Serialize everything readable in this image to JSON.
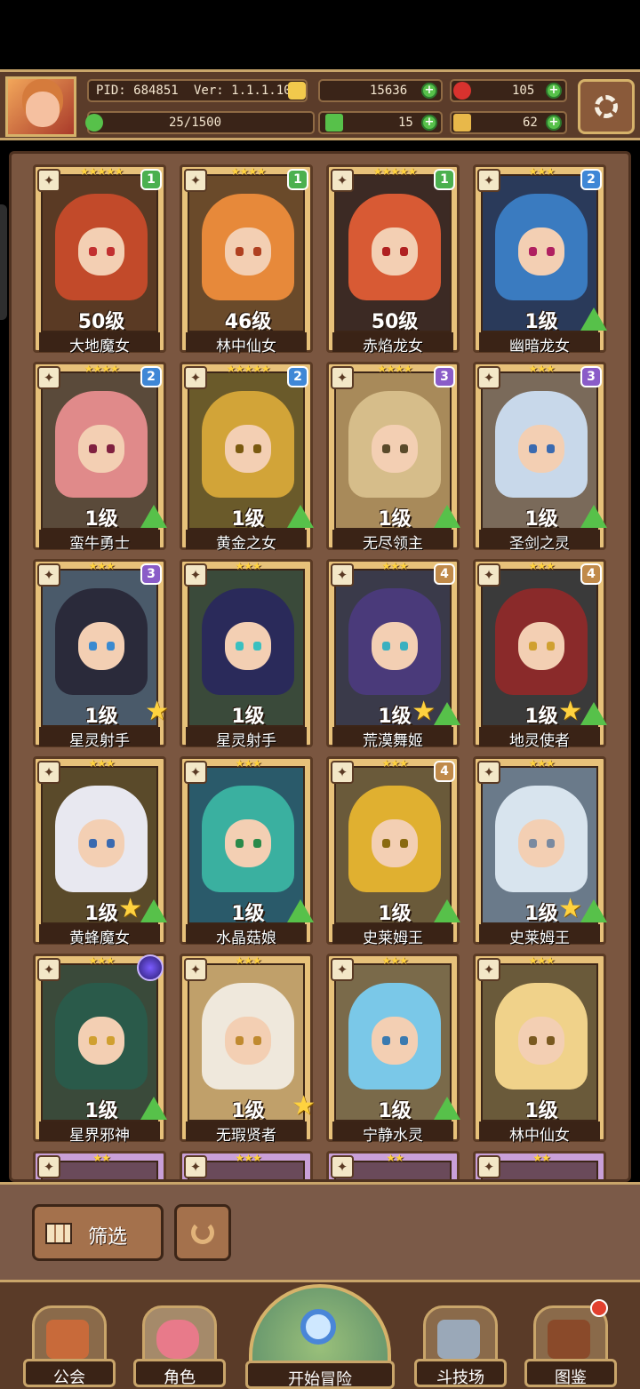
{
  "header": {
    "pid": "PID: 684851",
    "version": "Ver: 1.1.1.10",
    "exp": "25/1500",
    "gold": "15636",
    "gems": "105",
    "clover": "15",
    "keys": "62"
  },
  "colors": {
    "plus": "#57c14a",
    "accent_gold": "#d6b26a",
    "panel": "#5b3c2a"
  },
  "characters": [
    {
      "name": "大地魔女",
      "level": "50级",
      "stars": "★★★★★",
      "badge": "1",
      "badge_color": "#4bb04f",
      "icon": "staff-icon",
      "hair": "#c24a2a",
      "eye": "#c23030",
      "bg": "#5a3a24",
      "status": "none"
    },
    {
      "name": "林中仙女",
      "level": "46级",
      "stars": "★★★★",
      "badge": "1",
      "badge_color": "#4bb04f",
      "icon": "leaf-icon",
      "hair": "#e7893a",
      "eye": "#b04020",
      "bg": "#6a4a2a",
      "status": "none"
    },
    {
      "name": "赤焰龙女",
      "level": "50级",
      "stars": "★★★★★",
      "badge": "1",
      "badge_color": "#4bb04f",
      "icon": "staff-icon",
      "hair": "#d85a34",
      "eye": "#b02020",
      "bg": "#3c2a24",
      "status": "none"
    },
    {
      "name": "幽暗龙女",
      "level": "1级",
      "stars": "★★★",
      "badge": "2",
      "badge_color": "#3f87d6",
      "icon": "staff-icon",
      "hair": "#3a7bc0",
      "eye": "#b02060",
      "bg": "#2a3a5a",
      "status": "upgrade"
    },
    {
      "name": "蛮牛勇士",
      "level": "1级",
      "stars": "★★★★",
      "badge": "2",
      "badge_color": "#3f87d6",
      "icon": "sword-icon",
      "hair": "#e08a8a",
      "eye": "#802040",
      "bg": "#5a4a3a",
      "status": "upgrade"
    },
    {
      "name": "黄金之女",
      "level": "1级",
      "stars": "★★★★★",
      "badge": "2",
      "badge_color": "#3f87d6",
      "icon": "staff-icon",
      "hair": "#d2a438",
      "eye": "#7a5a10",
      "bg": "#6a5a2a",
      "status": "upgrade"
    },
    {
      "name": "无尽领主",
      "level": "1级",
      "stars": "★★★★",
      "badge": "3",
      "badge_color": "#8a5cc8",
      "icon": "staff-icon",
      "hair": "#d6bd8a",
      "eye": "#5a4a2a",
      "bg": "#a88a5a",
      "status": "upgrade"
    },
    {
      "name": "圣剑之灵",
      "level": "1级",
      "stars": "★★★",
      "badge": "3",
      "badge_color": "#8a5cc8",
      "icon": "sword-icon",
      "hair": "#c8d8ea",
      "eye": "#3a6ab0",
      "bg": "#7a6a5a",
      "status": "upgrade"
    },
    {
      "name": "星灵射手",
      "level": "1级",
      "stars": "★★★",
      "badge": "3",
      "badge_color": "#8a5cc8",
      "icon": "staff-icon",
      "hair": "#2a2a3a",
      "eye": "#3a8ad0",
      "bg": "#4a5a6a",
      "status": "star"
    },
    {
      "name": "星灵射手",
      "level": "1级",
      "stars": "★★★",
      "badge": "",
      "badge_color": "",
      "icon": "bow-icon",
      "hair": "#2a2a5a",
      "eye": "#3ac0c0",
      "bg": "#3a4a3a",
      "status": "none"
    },
    {
      "name": "荒漠舞姬",
      "level": "1级",
      "stars": "★★★",
      "badge": "4",
      "badge_color": "#c08a4a",
      "icon": "staff-icon",
      "hair": "#4a3a7a",
      "eye": "#3ab0c0",
      "bg": "#3a3a4a",
      "status": "star-upgrade"
    },
    {
      "name": "地灵使者",
      "level": "1级",
      "stars": "★★★",
      "badge": "4",
      "badge_color": "#c08a4a",
      "icon": "staff-icon",
      "hair": "#8a2a2a",
      "eye": "#d0a030",
      "bg": "#3a3a3a",
      "status": "star-upgrade"
    },
    {
      "name": "黄蜂魔女",
      "level": "1级",
      "stars": "★★★",
      "badge": "",
      "badge_color": "",
      "icon": "staff-icon",
      "hair": "#e8e8f0",
      "eye": "#3a6ab0",
      "bg": "#5a4a2a",
      "status": "star-upgrade"
    },
    {
      "name": "水晶菇娘",
      "level": "1级",
      "stars": "★★★",
      "badge": "",
      "badge_color": "",
      "icon": "staff-icon",
      "hair": "#3ab0a0",
      "eye": "#2a8a4a",
      "bg": "#2a5a6a",
      "status": "upgrade"
    },
    {
      "name": "史莱姆王",
      "level": "1级",
      "stars": "★★★",
      "badge": "4",
      "badge_color": "#c08a4a",
      "icon": "staff-icon",
      "hair": "#e0b030",
      "eye": "#8a6a10",
      "bg": "#6a5a3a",
      "status": "upgrade"
    },
    {
      "name": "史莱姆王",
      "level": "1级",
      "stars": "★★★",
      "badge": "",
      "badge_color": "",
      "icon": "staff-icon",
      "hair": "#d8e4ee",
      "eye": "#7a8aa0",
      "bg": "#6a7a8a",
      "status": "star-upgrade"
    },
    {
      "name": "星界邪神",
      "level": "1级",
      "stars": "★★★",
      "badge": "",
      "badge_color": "",
      "icon": "staff-icon",
      "hair": "#2a5a4a",
      "eye": "#d0a030",
      "bg": "#3a4a3a",
      "status": "upgrade"
    },
    {
      "name": "无瑕贤者",
      "level": "1级",
      "stars": "★★★",
      "badge": "",
      "badge_color": "",
      "icon": "sword-icon",
      "hair": "#efe8dc",
      "eye": "#c08a30",
      "bg": "#c0a06a",
      "status": "star"
    },
    {
      "name": "宁静水灵",
      "level": "1级",
      "stars": "★★★",
      "badge": "",
      "badge_color": "",
      "icon": "staff-icon",
      "hair": "#7ac8e8",
      "eye": "#3a7ab0",
      "bg": "#7a6a4a",
      "status": "upgrade"
    },
    {
      "name": "林中仙女",
      "level": "1级",
      "stars": "★★★",
      "badge": "",
      "badge_color": "",
      "icon": "sword-icon",
      "hair": "#f0d28a",
      "eye": "#7a5a20",
      "bg": "#6a5a3a",
      "status": "none"
    }
  ],
  "partial_row_stars": [
    "★★",
    "★★★",
    "★★",
    "★★"
  ],
  "controls": {
    "filter_label": "筛选"
  },
  "nav": {
    "guild": "公会",
    "character": "角色",
    "adventure": "开始冒险",
    "arena": "斗技场",
    "codex": "图鉴"
  }
}
